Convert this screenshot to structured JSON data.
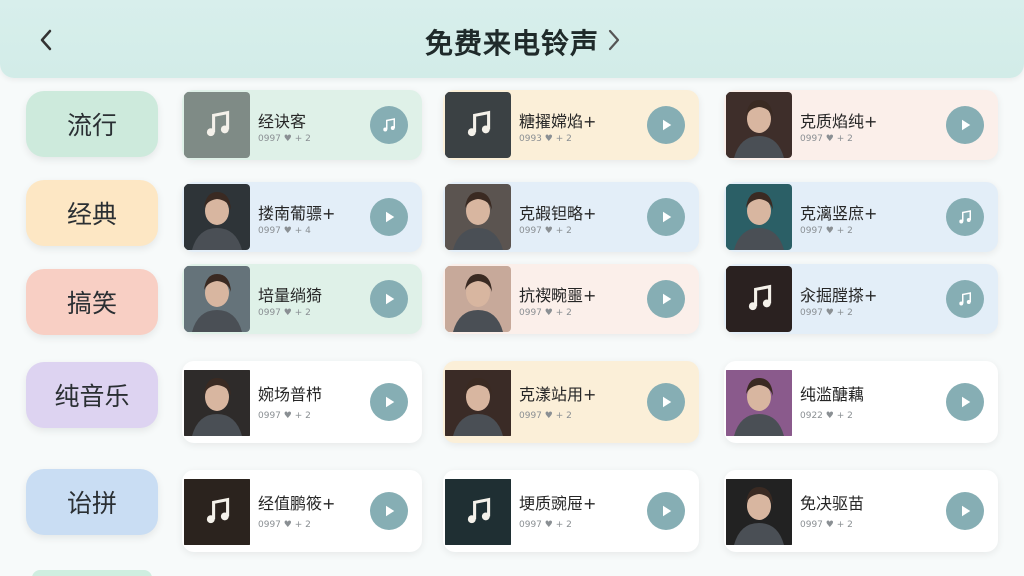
{
  "header": {
    "title": "免费来电铃声"
  },
  "categories": [
    {
      "label": "流行",
      "color": "#cdeadc"
    },
    {
      "label": "经典",
      "color": "#fde7c4"
    },
    {
      "label": "搞笑",
      "color": "#f8cfc4"
    },
    {
      "label": "纯音乐",
      "color": "#ddd3f1"
    },
    {
      "label": "诒拼",
      "color": "#c9ddf3"
    }
  ],
  "rows": [
    [
      {
        "title": "经诀客",
        "meta": "0997  ♥ + 2",
        "thumb": "note-icon",
        "button": "note-icon",
        "bg": "#dff1e8"
      },
      {
        "title": "糖擢嫦焰+",
        "meta": "0993  ♥ + 2",
        "thumb": "note-icon",
        "button": "play-icon",
        "bg": "#fbefd8"
      },
      {
        "title": "克质焰纯+",
        "meta": "0997  ♥ + 2",
        "thumb": "person-icon",
        "button": "play-icon",
        "bg": "#fbefea"
      }
    ],
    [
      {
        "title": "搂南葡骠+",
        "meta": "0997  ♥ + 4",
        "thumb": "person-icon",
        "button": "play-icon",
        "bg": "#e3eef8"
      },
      {
        "title": "克嘏钽略+",
        "meta": "0997  ♥ + 2",
        "thumb": "person-icon",
        "button": "play-icon",
        "bg": "#e3eef8"
      },
      {
        "title": "克漓竖庶+",
        "meta": "0997  ♥ + 2",
        "thumb": "person-icon",
        "button": "note-icon",
        "bg": "#e3eef8"
      }
    ],
    [
      {
        "title": "培量绱猗",
        "meta": "0997  ♥ + 2",
        "thumb": "person-icon",
        "button": "play-icon",
        "bg": "#dff1e8"
      },
      {
        "title": "抗禊畹噩+",
        "meta": "0997  ♥ + 2",
        "thumb": "person-icon",
        "button": "play-icon",
        "bg": "#fbefea"
      },
      {
        "title": "汆掘膛搽+",
        "meta": "0997  ♥ + 2",
        "thumb": "note-icon",
        "button": "note-icon",
        "bg": "#e3eef8"
      }
    ],
    [
      {
        "title": "婉场普栉",
        "meta": "0997  ♥ + 2",
        "thumb": "person-icon",
        "button": "play-icon",
        "bg": "#ffffff"
      },
      {
        "title": "克漾站用+",
        "meta": "0997  ♥ + 2",
        "thumb": "person-icon",
        "button": "play-icon",
        "bg": "#fbefd8"
      },
      {
        "title": "纯滥醣藕",
        "meta": "0922  ♥ + 2",
        "thumb": "person-icon",
        "button": "play-icon",
        "bg": "#ffffff"
      }
    ],
    [
      {
        "title": "经值鹏筱+",
        "meta": "0997  ♥ + 2",
        "thumb": "note-icon",
        "button": "play-icon",
        "bg": "#ffffff"
      },
      {
        "title": "埂质豌屉+",
        "meta": "0997  ♥ + 2",
        "thumb": "note-icon",
        "button": "play-icon",
        "bg": "#ffffff"
      },
      {
        "title": "免决驱苗",
        "meta": "0997  ♥ + 2",
        "thumb": "person-icon",
        "button": "play-icon",
        "bg": "#ffffff"
      }
    ]
  ],
  "colors": {
    "accent": "#86aeb4",
    "header_bg": "#d2ece8"
  }
}
